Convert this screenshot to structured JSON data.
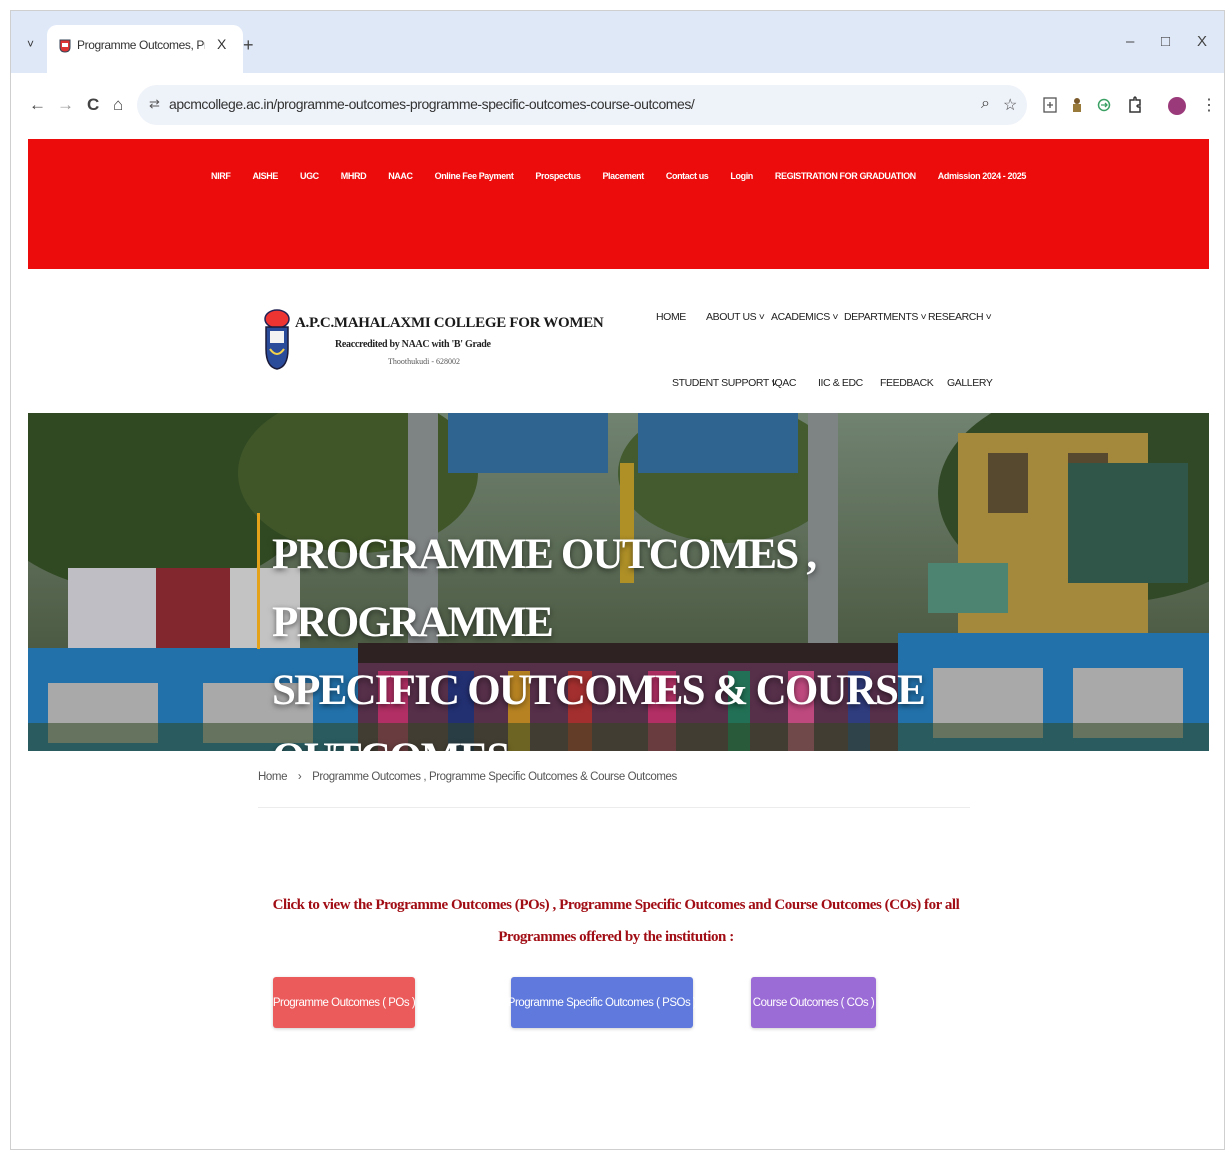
{
  "browser": {
    "tab_title": "Programme Outcomes, Progra",
    "tab_close": "X",
    "new_tab": "+",
    "tab_menu": "˅",
    "url": "apcmcollege.ac.in/programme-outcomes-programme-specific-outcomes-course-outcomes/",
    "window": {
      "minimize": "–",
      "restore": "□",
      "close": "X"
    },
    "nav": {
      "back": "←",
      "forward": "→",
      "reload": "C",
      "home": "⌂",
      "site_info": "⇄",
      "zoom": "⌕",
      "bookmark": "☆",
      "menu": "⋮"
    }
  },
  "top_links": [
    "NIRF",
    "AISHE",
    "UGC",
    "MHRD",
    "NAAC",
    "Online Fee Payment",
    "Prospectus",
    "Placement",
    "Contact us",
    "Login",
    "REGISTRATION FOR GRADUATION",
    "Admission 2024 - 2025"
  ],
  "college": {
    "name": "A.P.C.MAHALAXMI COLLEGE FOR WOMEN",
    "accreditation": "Reaccredited by NAAC with 'B' Grade",
    "place": "Thoothukudi - 628002"
  },
  "main_nav": {
    "home": "HOME",
    "about": "ABOUT US ˅",
    "academics": "ACADEMICS ˅",
    "departments": "DEPARTMENTS ˅",
    "research": "RESEARCH ˅",
    "student_support": "STUDENT SUPPORT ˅",
    "iqac": "IQAC",
    "iic": "IIC & EDC",
    "feedback": "FEEDBACK",
    "gallery": "GALLERY"
  },
  "hero": {
    "title_line1": "PROGRAMME OUTCOMES , PROGRAMME",
    "title_line2": "SPECIFIC OUTCOMES & COURSE OUTCOMES"
  },
  "breadcrumb": {
    "home": "Home",
    "separator": "›",
    "current": "Programme Outcomes , Programme Specific Outcomes & Course Outcomes"
  },
  "intro_text": "Click to view the Programme Outcomes (POs) , Programme Specific Outcomes and Course Outcomes (COs) for all Programmes offered by the institution :",
  "buttons": {
    "po": "Programme Outcomes ( POs )",
    "pso": "Programme Specific Outcomes ( PSOs )",
    "co": "Course Outcomes ( COs )"
  },
  "colors": {
    "top_bar": "#ec0c0c",
    "intro_text": "#a10d14",
    "btn_po": "#ec5b5b",
    "btn_pso": "#5f79dc",
    "btn_co": "#9b6bd6",
    "hero_accent": "#e3a21a"
  }
}
